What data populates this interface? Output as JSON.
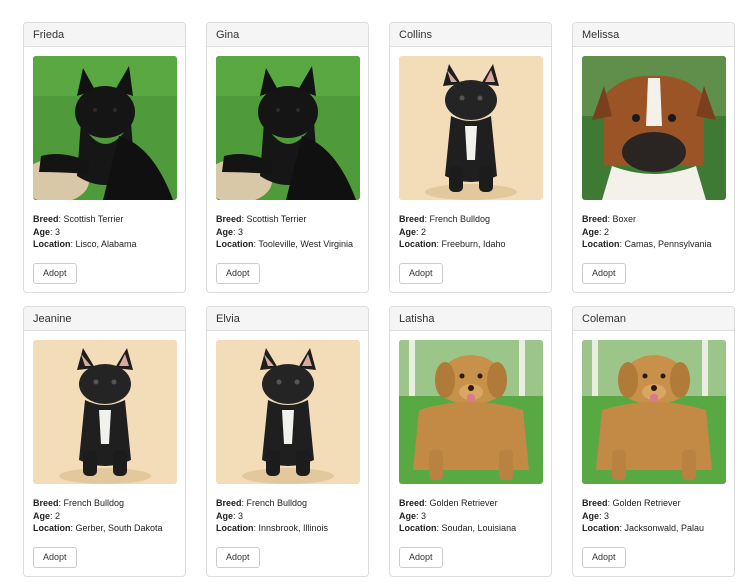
{
  "labels": {
    "breed": "Breed",
    "age": "Age",
    "location": "Location",
    "adopt_button": "Adopt"
  },
  "pets": [
    {
      "name": "Frieda",
      "breed": "Scottish Terrier",
      "age": "3",
      "location": "Lisco, Alabama",
      "photo_icon": "scottish-terrier-photo"
    },
    {
      "name": "Gina",
      "breed": "Scottish Terrier",
      "age": "3",
      "location": "Tooleville, West Virginia",
      "photo_icon": "scottish-terrier-photo"
    },
    {
      "name": "Collins",
      "breed": "French Bulldog",
      "age": "2",
      "location": "Freeburn, Idaho",
      "photo_icon": "french-bulldog-photo"
    },
    {
      "name": "Melissa",
      "breed": "Boxer",
      "age": "2",
      "location": "Camas, Pennsylvania",
      "photo_icon": "boxer-photo"
    },
    {
      "name": "Jeanine",
      "breed": "French Bulldog",
      "age": "2",
      "location": "Gerber, South Dakota",
      "photo_icon": "french-bulldog-photo"
    },
    {
      "name": "Elvia",
      "breed": "French Bulldog",
      "age": "3",
      "location": "Innsbrook, Illinois",
      "photo_icon": "french-bulldog-photo"
    },
    {
      "name": "Latisha",
      "breed": "Golden Retriever",
      "age": "3",
      "location": "Soudan, Louisiana",
      "photo_icon": "golden-retriever-photo"
    },
    {
      "name": "Coleman",
      "breed": "Golden Retriever",
      "age": "3",
      "location": "Jacksonwald, Palau",
      "photo_icon": "golden-retriever-photo"
    }
  ],
  "colors": {
    "panel_heading_bg": "#f5f5f5",
    "panel_border": "#dddddd",
    "grass_green": "#4f9a3a",
    "cream_backdrop": "#f3dcb8",
    "golden_coat": "#c7914a"
  }
}
